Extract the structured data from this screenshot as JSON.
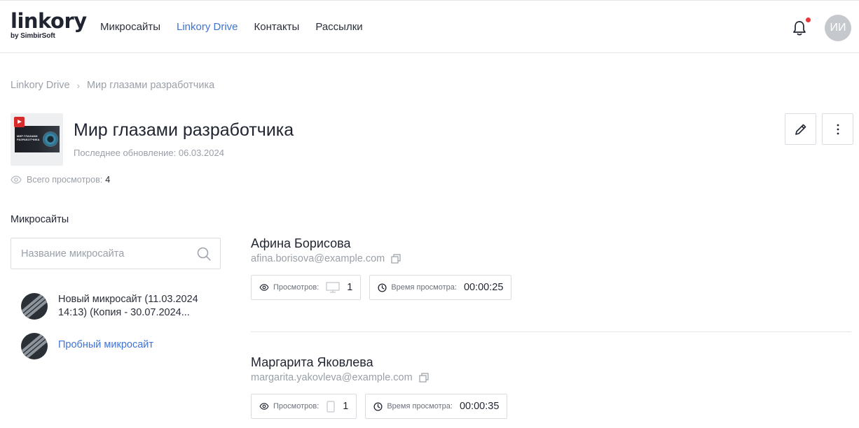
{
  "logo": {
    "main": "linkory",
    "sub": "by SimbirSoft"
  },
  "nav": [
    {
      "label": "Микросайты",
      "active": false
    },
    {
      "label": "Linkory Drive",
      "active": true
    },
    {
      "label": "Контакты",
      "active": false
    },
    {
      "label": "Рассылки",
      "active": false
    }
  ],
  "user": {
    "initials": "ИИ",
    "has_notifications": true
  },
  "breadcrumb": {
    "root": "Linkory Drive",
    "current": "Мир глазами разработчика"
  },
  "file": {
    "thumbnail_text": "МИР ГЛАЗАМИ РАЗРАБОТЧИКА",
    "title": "Мир глазами разработчика",
    "updated_label": "Последнее обновление:",
    "updated_value": "06.03.2024",
    "views_label": "Всего просмотров:",
    "views_value": "4"
  },
  "microsites": {
    "title": "Микросайты",
    "search_placeholder": "Название микросайта",
    "items": [
      {
        "label": "Новый микросайт (11.03.2024 14:13) (Копия - 30.07.2024...",
        "link": false
      },
      {
        "label": "Пробный микросайт",
        "link": true
      }
    ]
  },
  "viewers": [
    {
      "name": "Афина Борисова",
      "email": "afina.borisova@example.com",
      "views_label": "Просмотров:",
      "device": "desktop",
      "views": "1",
      "time_label": "Время просмотра:",
      "time": "00:00:25"
    },
    {
      "name": "Маргарита Яковлева",
      "email": "margarita.yakovleva@example.com",
      "views_label": "Просмотров:",
      "device": "mobile",
      "views": "1",
      "time_label": "Время просмотра:",
      "time": "00:00:35"
    }
  ],
  "colors": {
    "accent": "#3f73d4",
    "notification": "#e33a3a",
    "muted": "#9aa0a8"
  }
}
